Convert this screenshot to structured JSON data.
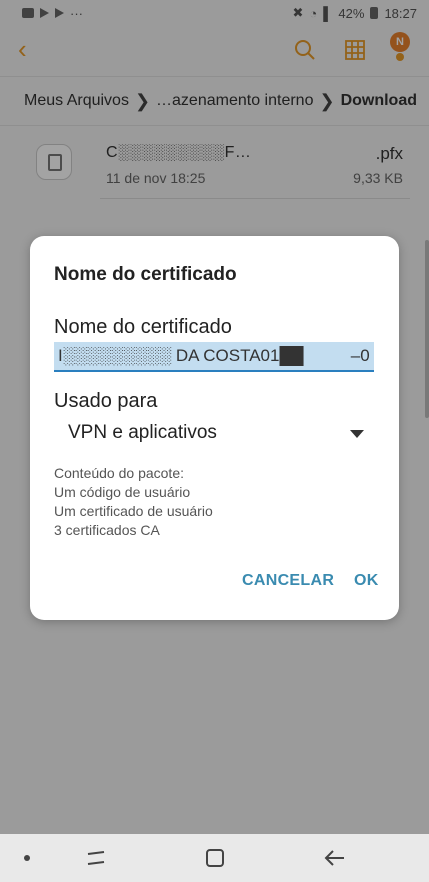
{
  "status_bar": {
    "battery": "42%",
    "time": "18:27",
    "overflow": "···"
  },
  "toolbar": {
    "back_icon": "back-chevron-icon",
    "search_icon": "search-icon",
    "grid_icon": "grid-view-icon",
    "profile_initial": "N"
  },
  "breadcrumb": {
    "items": [
      "Meus Arquivos",
      "…azenamento interno",
      "Download"
    ]
  },
  "file": {
    "name": "C░░░░░░░░░F…",
    "extension": ".pfx",
    "date": "11 de nov 18:25",
    "size": "9,33 KB"
  },
  "dialog": {
    "title": "Nome do certificado",
    "name_label": "Nome do certificado",
    "name_value": "I░░░░░░░░░ DA COSTA01██          –0",
    "usage_label": "Usado para",
    "usage_value": "VPN e aplicativos",
    "package_title": "Conteúdo do pacote:",
    "package_items": [
      "Um código de usuário",
      "Um certificado de usuário",
      "3 certificados CA"
    ],
    "cancel_label": "CANCELAR",
    "ok_label": "OK"
  },
  "colors": {
    "accent_orange": "#e69a2a",
    "button_blue": "#3a8bb0",
    "input_highlight": "#c3ddf0"
  }
}
